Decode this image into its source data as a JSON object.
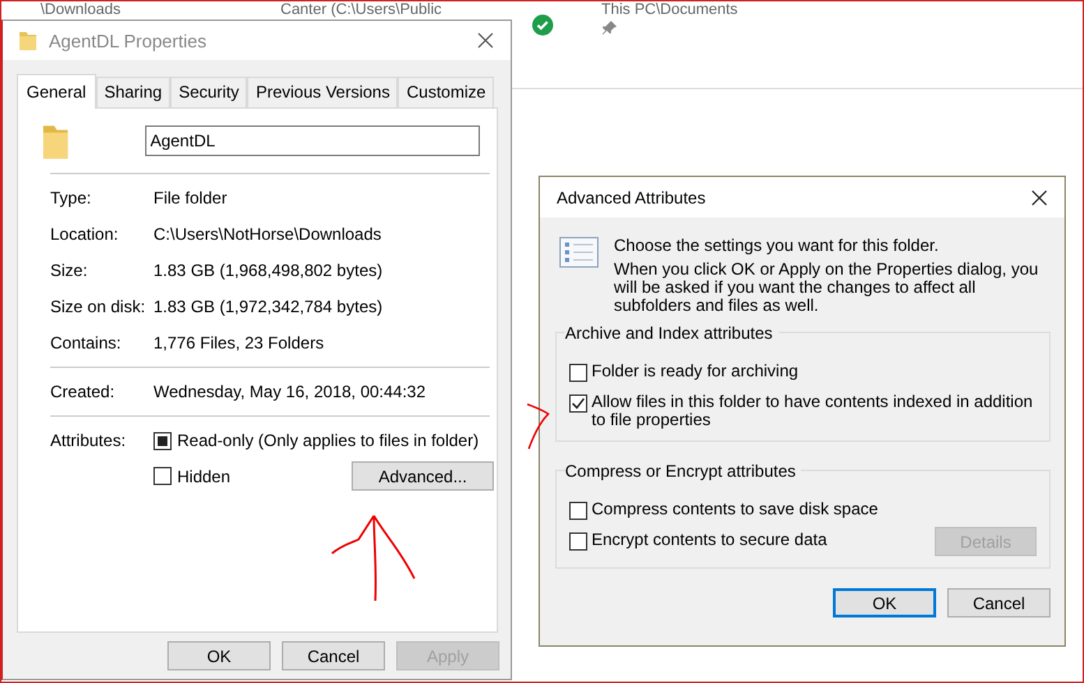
{
  "background": {
    "items": [
      {
        "text": "\\Downloads"
      },
      {
        "text": "Canter (C:\\Users\\Public"
      },
      {
        "text": "This PC\\Documents"
      }
    ]
  },
  "properties": {
    "title": "AgentDL Properties",
    "tabs": [
      {
        "label": "General",
        "selected": true
      },
      {
        "label": "Sharing",
        "selected": false
      },
      {
        "label": "Security",
        "selected": false
      },
      {
        "label": "Previous Versions",
        "selected": false
      },
      {
        "label": "Customize",
        "selected": false
      }
    ],
    "name": "AgentDL",
    "sections": [
      [
        {
          "label": "Type:",
          "value": "File folder"
        },
        {
          "label": "Location:",
          "value": "C:\\Users\\NotHorse\\Downloads"
        },
        {
          "label": "Size:",
          "value": "1.83 GB (1,968,498,802 bytes)"
        },
        {
          "label": "Size on disk:",
          "value": "1.83 GB (1,972,342,784 bytes)"
        },
        {
          "label": "Contains:",
          "value": "1,776 Files, 23 Folders"
        }
      ],
      [
        {
          "label": "Created:",
          "value": "Wednesday, May 16, 2018, 00:44:32"
        }
      ]
    ],
    "attributes_label": "Attributes:",
    "attributes": [
      {
        "label": "Read-only (Only applies to files in folder)",
        "checked": false,
        "mixed": true
      },
      {
        "label": "Hidden",
        "checked": false,
        "mixed": false
      }
    ],
    "advanced_button": "Advanced...",
    "buttons": [
      {
        "label": "OK",
        "disabled": false
      },
      {
        "label": "Cancel",
        "disabled": false
      },
      {
        "label": "Apply",
        "disabled": true
      }
    ]
  },
  "advanced": {
    "title": "Advanced Attributes",
    "intro": "Choose the settings you want for this folder.",
    "note": "When you click OK or Apply on the Properties dialog, you will be asked if you want the changes to affect all subfolders and files as well.",
    "groups": [
      {
        "title": "Archive and Index attributes",
        "options": [
          {
            "label": "Folder is ready for archiving",
            "checked": false
          },
          {
            "label": "Allow files in this folder to have contents indexed in addition to file properties",
            "checked": true
          }
        ]
      },
      {
        "title": "Compress or Encrypt attributes",
        "options": [
          {
            "label": "Compress contents to save disk space",
            "checked": false
          },
          {
            "label": "Encrypt contents to secure data",
            "checked": false
          }
        ],
        "details_button": {
          "label": "Details",
          "disabled": true
        }
      }
    ],
    "buttons": [
      {
        "label": "OK",
        "default": true
      },
      {
        "label": "Cancel",
        "default": false
      }
    ]
  }
}
